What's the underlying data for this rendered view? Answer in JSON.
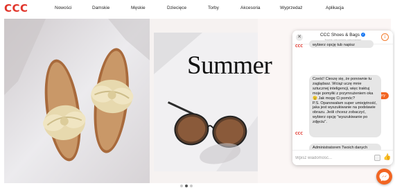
{
  "header": {
    "logo_text": "CCC",
    "nav": [
      "Nowości",
      "Damskie",
      "Męskie",
      "Dziecięce",
      "Torby",
      "Akcesoria",
      "Wyprzedaż",
      "Aplikacja"
    ]
  },
  "hero": {
    "headline": "Summer",
    "slides_total": 3,
    "active_slide": 2
  },
  "chat": {
    "title": "CCC Shoes & Bags",
    "subtitle": "Zwykle odpowiada natychmiast",
    "avatar_text": "CCC",
    "partial_message": "wybierz opcję tub napisz",
    "timestamp": "7:21 PO POŁUDNIU",
    "user_message": "dzień dobry",
    "bot_message": "Cześć! Cieszę się, że ponownie tu zaglądasz. Wciąż uczę mnie sztucznej inteligencji, więc traktuj moje pomyłki z przymrużeniem oka 😉 Jak mogę Ci pomóc?\nP.S. Opanowałam super umiejętność, jaka jest wyszukiwanie na podstawie obrazu. Jeśli chcesz zobaczyć, wybierz opcję \"wyszukiwanie po zdjęciu\".",
    "bot_message_2": "Administratorem Twoich danych",
    "input_placeholder": "Wpisz wiadomość...",
    "icons": {
      "close": "close-icon",
      "info": "info-icon",
      "verified": "verified-badge-icon",
      "gif": "gif-icon",
      "like": "thumbs-up-icon",
      "launcher": "messenger-icon"
    }
  },
  "colors": {
    "brand": "#e1352b",
    "accent": "#f26522"
  }
}
